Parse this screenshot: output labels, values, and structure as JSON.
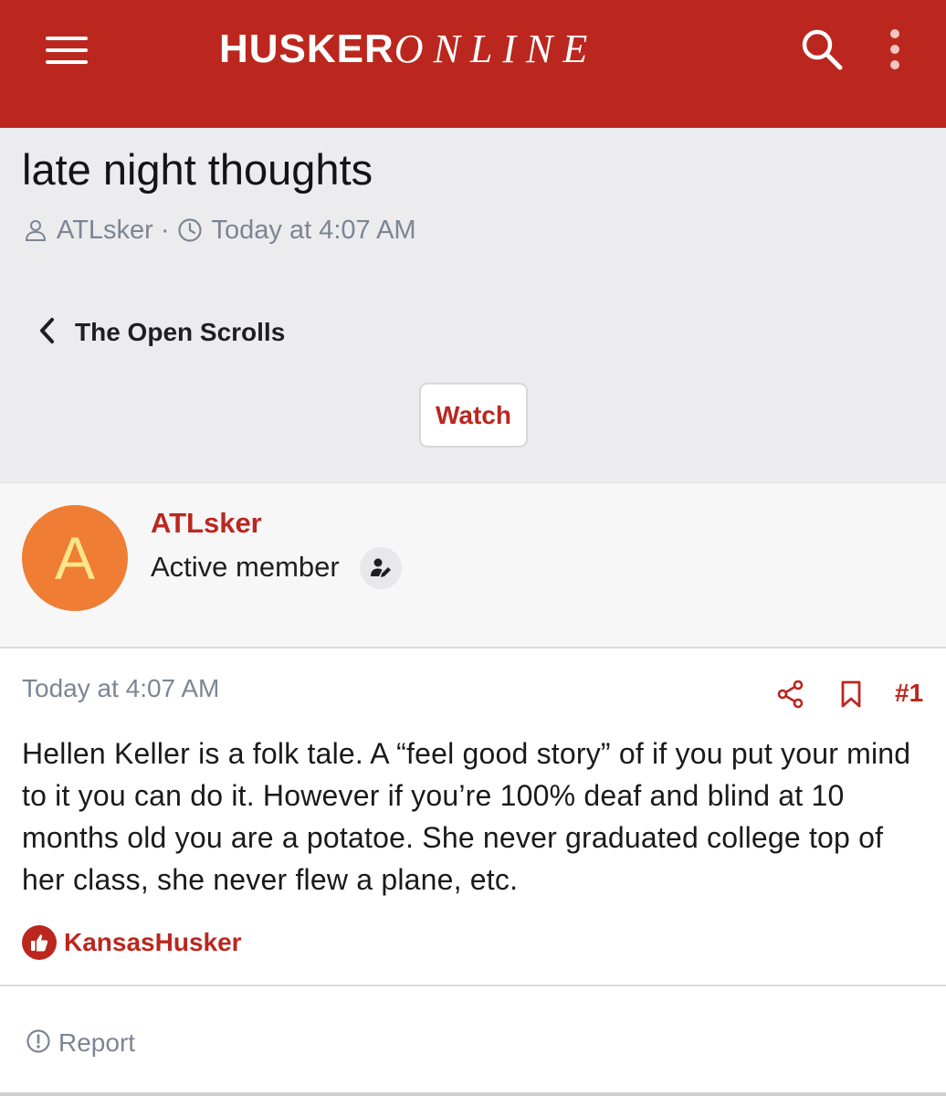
{
  "header": {
    "logo_primary": "HUSKER",
    "logo_secondary": "ONLINE",
    "menu_icon": "hamburger-menu-icon",
    "search_icon": "search-icon",
    "more_icon": "vertical-ellipsis-icon",
    "brand_color": "#bb271e"
  },
  "thread": {
    "title": "late night thoughts",
    "author": "ATLsker",
    "separator": "·",
    "timestamp": "Today at 4:07 AM",
    "breadcrumb": "The Open Scrolls",
    "watch_label": "Watch"
  },
  "author_block": {
    "avatar_letter": "A",
    "avatar_color": "#ef7d33",
    "name": "ATLsker",
    "role": "Active member"
  },
  "post": {
    "timestamp": "Today at 4:07 AM",
    "post_number": "#1",
    "body": "Hellen Keller is a folk tale. A “feel good story” of if you put your mind to it you can do it. However if you’re 100% deaf and blind at 10 months old you are a potatoe. She never graduated college top of her class, she never flew a plane, etc.",
    "reaction_user": "KansasHusker",
    "report_label": "Report"
  }
}
